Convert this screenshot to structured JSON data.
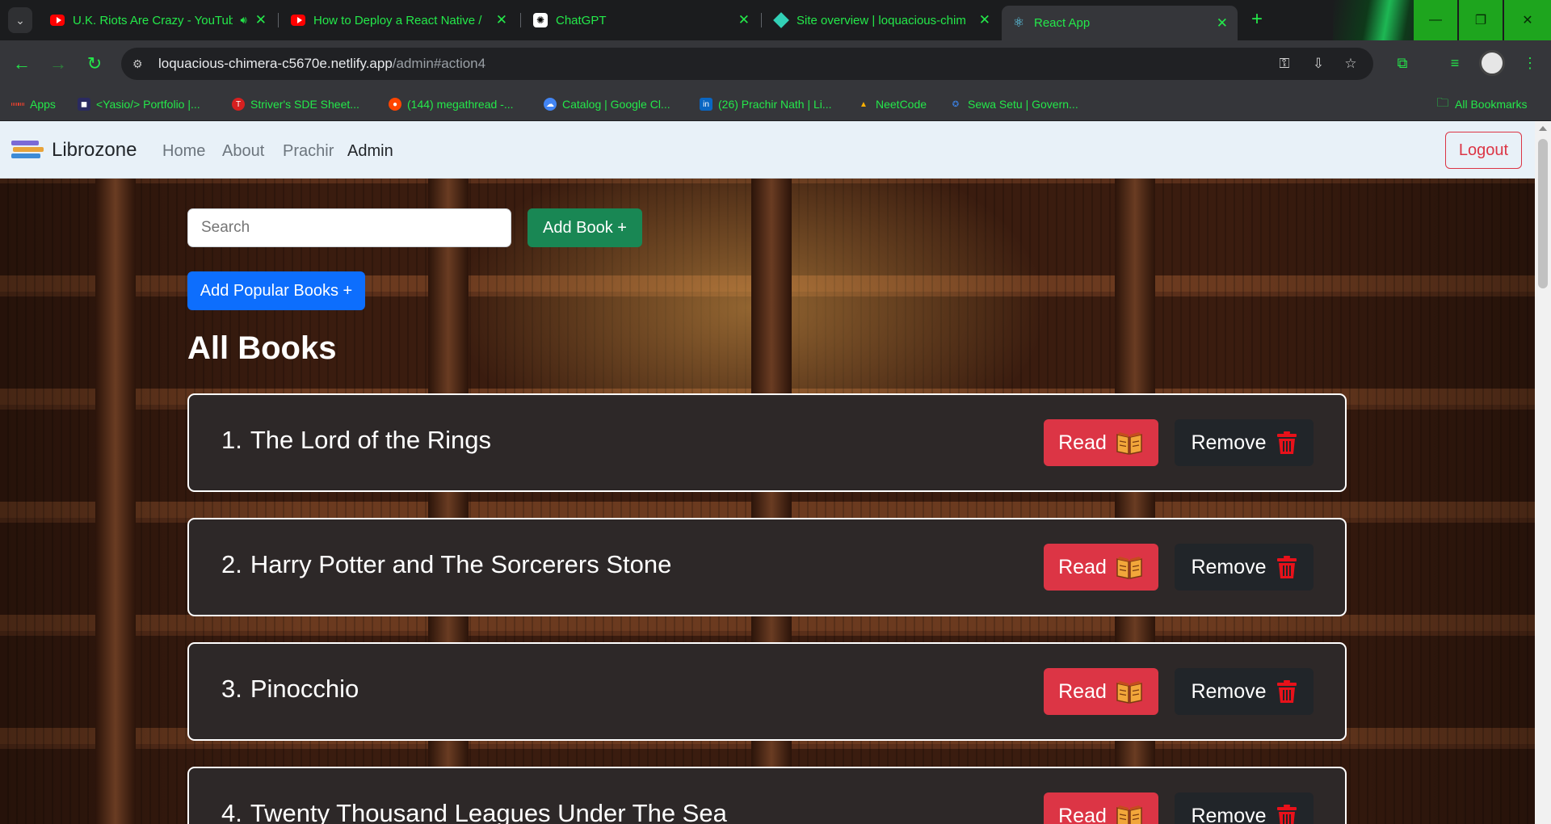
{
  "browser": {
    "tabs": [
      {
        "title": "U.K. Riots Are Crazy - YouTube",
        "icon": "youtube-icon",
        "muted": true
      },
      {
        "title": "How to Deploy a React Native /",
        "icon": "youtube-icon"
      },
      {
        "title": "ChatGPT",
        "icon": "chatgpt-icon"
      },
      {
        "title": "Site overview | loquacious-chim",
        "icon": "netlify-icon"
      },
      {
        "title": "React App",
        "icon": "react-icon",
        "active": true
      }
    ],
    "url_host": "loquacious-chimera-c5670e.netlify.app",
    "url_path": "/admin#action4",
    "bookmarks": [
      {
        "label": "Apps",
        "icon": "apps-grid-icon"
      },
      {
        "label": "<Yasio/> Portfolio |...",
        "icon": "portfolio-icon"
      },
      {
        "label": "Striver's SDE Sheet...",
        "icon": "tuf-icon"
      },
      {
        "label": "(144) megathread -...",
        "icon": "reddit-icon"
      },
      {
        "label": "Catalog | Google Cl...",
        "icon": "google-cloud-icon"
      },
      {
        "label": "(26) Prachir Nath | Li...",
        "icon": "linkedin-icon"
      },
      {
        "label": "NeetCode",
        "icon": "neetcode-icon"
      },
      {
        "label": "Sewa Setu | Govern...",
        "icon": "govt-emblem-icon"
      }
    ],
    "all_bookmarks": "All Bookmarks",
    "accent_color": "#24e84a"
  },
  "app": {
    "brand": "Librozone",
    "nav": [
      "Home",
      "About",
      "Prachir",
      "Admin"
    ],
    "active_nav": "Admin",
    "logout": "Logout",
    "search_placeholder": "Search",
    "add_book": "Add Book +",
    "add_popular": "Add Popular Books +",
    "heading": "All Books",
    "read_label": "Read",
    "remove_label": "Remove",
    "books": [
      {
        "num": "1.",
        "title": "The Lord of the Rings"
      },
      {
        "num": "2.",
        "title": "Harry Potter and The Sorcerers Stone"
      },
      {
        "num": "3.",
        "title": "Pinocchio"
      },
      {
        "num": "4.",
        "title": "Twenty Thousand Leagues Under The Sea"
      }
    ],
    "colors": {
      "read": "#dc3545",
      "remove": "#212529",
      "add": "#198754",
      "popular": "#0d6efd",
      "logout": "#dc3545"
    }
  }
}
